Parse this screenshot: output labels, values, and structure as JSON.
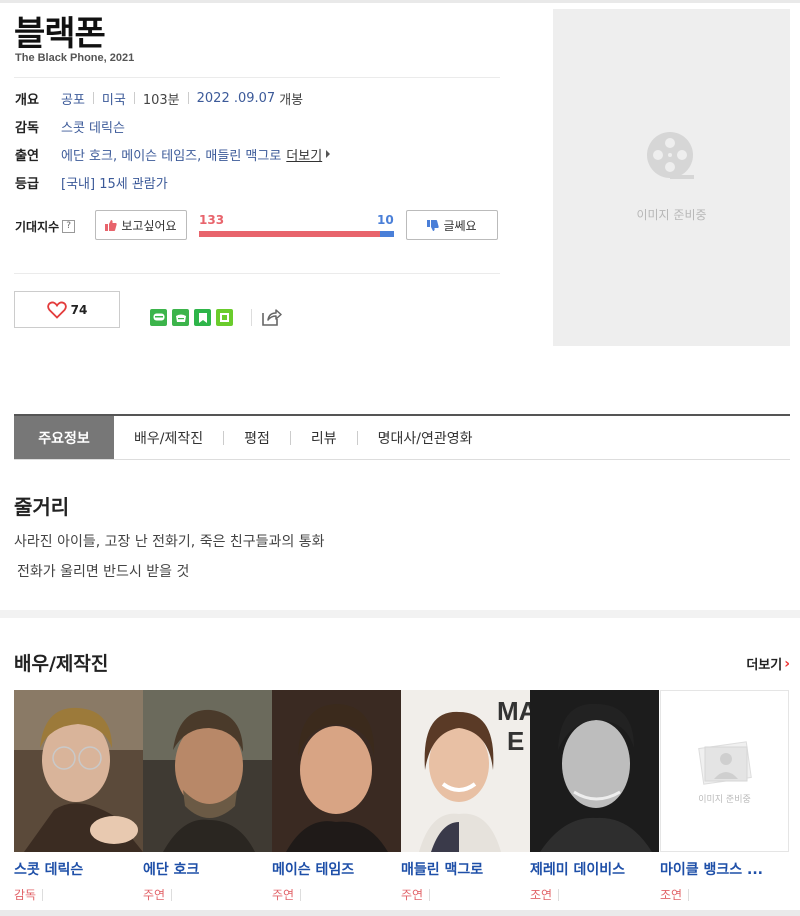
{
  "movie": {
    "title": "블랙폰",
    "subtitle": "The Black Phone, 2021"
  },
  "info": {
    "overview_label": "개요",
    "genre": "공포",
    "country": "미국",
    "runtime": "103분",
    "release_date": "2022 .09.07",
    "release_suffix": "개봉",
    "director_label": "감독",
    "director": "스콧 데릭슨",
    "cast_label": "출연",
    "cast_names": "에단 호크, 메이슨 테임즈, 매들린 맥그로",
    "cast_more": "더보기",
    "rating_label": "등급",
    "rating": "[국내] 15세 관람가"
  },
  "expectation": {
    "label": "기대지수",
    "help": "?",
    "want_button": "보고싶어요",
    "want_count": "133",
    "want_fraction": 0.93,
    "no_count": "10",
    "no_button": "글쎄요"
  },
  "like": {
    "count": "74"
  },
  "poster": {
    "placeholder": "이미지 준비중"
  },
  "tabs": [
    "주요정보",
    "배우/제작진",
    "평점",
    "리뷰",
    "명대사/연관영화"
  ],
  "plot": {
    "title": "줄거리",
    "lines": [
      "사라진 아이들, 고장 난 전화기, 죽은 친구들과의 통화",
      "전화가 울리면 반드시 받을 것"
    ]
  },
  "cast_section": {
    "title": "배우/제작진",
    "more": "더보기",
    "members": [
      {
        "name": "스콧 데릭슨",
        "role": "감독"
      },
      {
        "name": "에단 호크",
        "role": "주연"
      },
      {
        "name": "메이슨 테임즈",
        "role": "주연"
      },
      {
        "name": "매들린 맥그로",
        "role": "주연"
      },
      {
        "name": "제레미 데이비스",
        "role": "조연"
      },
      {
        "name": "마이클 뱅크스 ...",
        "role": "조연"
      }
    ],
    "noimg_placeholder": "이미지 준비중"
  },
  "colors": {
    "link": "#3c5a99",
    "want": "#e8646c",
    "no": "#4a7fd8",
    "role": "#e2646a"
  }
}
